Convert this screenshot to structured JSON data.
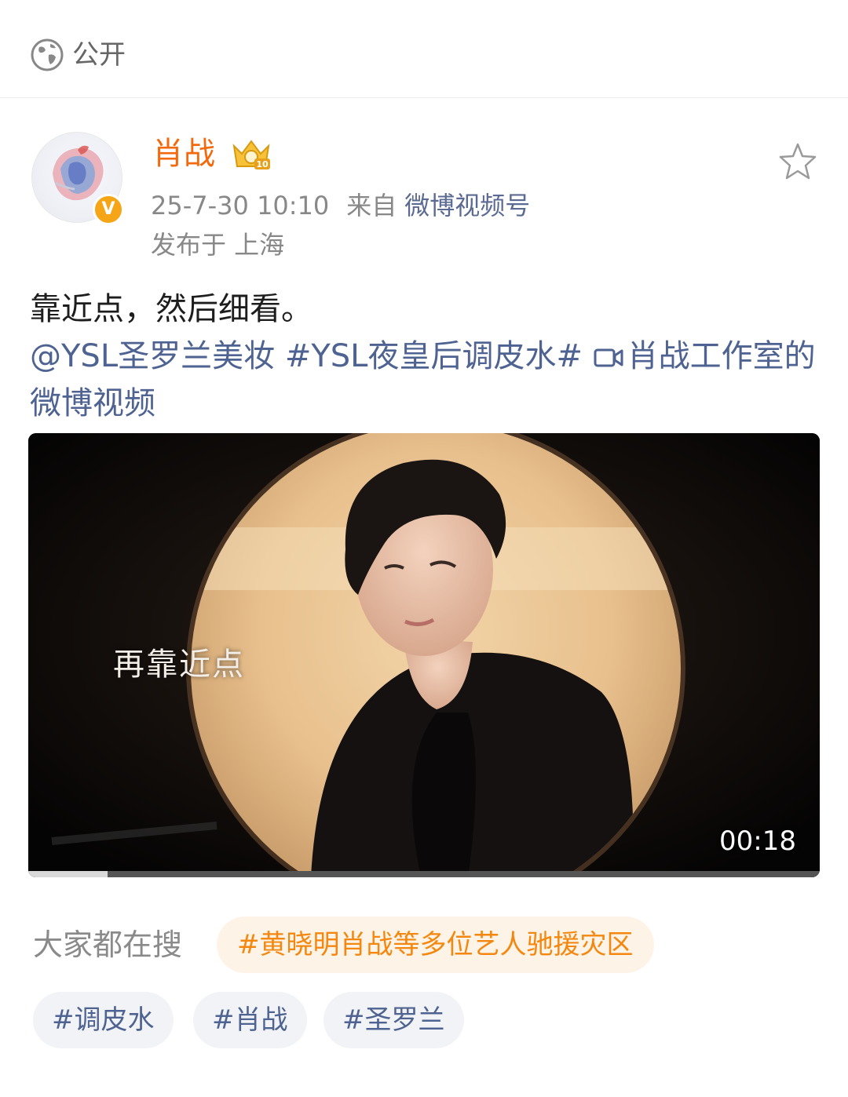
{
  "header": {
    "visibility_label": "公开",
    "visibility_icon": "globe-icon"
  },
  "post": {
    "author": "肖战",
    "verified_badge": "V",
    "timestamp": "25-7-30 10:10",
    "from_label": "来自",
    "source": "微博视频号",
    "location": "发布于 上海",
    "text": "靠近点，然后细看。",
    "mention": "@YSL圣罗兰美妆",
    "hashtag": "#YSL夜皇后调皮水#",
    "video_link": "肖战工作室的微博视频"
  },
  "video": {
    "caption": "再靠近点",
    "duration": "00:18",
    "progress_fraction": 0.1
  },
  "trending": {
    "label": "大家都在搜",
    "topic": "#黄晓明肖战等多位艺人驰援灾区"
  },
  "tags": [
    "#调皮水",
    "#肖战",
    "#圣罗兰"
  ],
  "colors": {
    "username": "#f26a0d",
    "link": "#4e6391",
    "trending": "#f4870f",
    "badge": "#f5a516"
  }
}
